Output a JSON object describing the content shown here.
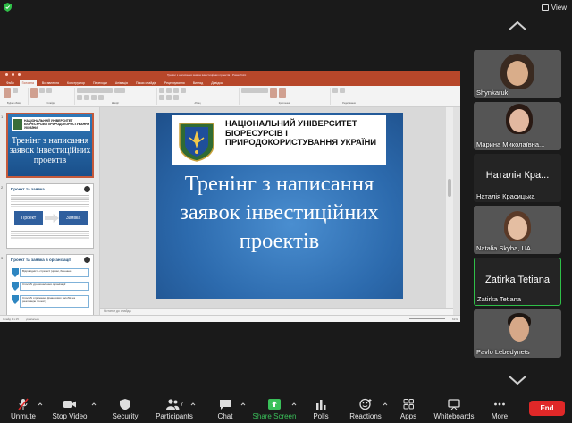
{
  "app": {
    "view_label": "View",
    "colors": {
      "share_green": "#3ac05a",
      "end_red": "#e02828",
      "ppt_accent": "#b7472a"
    }
  },
  "presentation": {
    "window_title": "Тренінг з написання заявок інвестиційних проектів - PowerPoint",
    "tabs": [
      "Файл",
      "Головна",
      "Вставлення",
      "Конструктор",
      "Переходи",
      "Анімація",
      "Показ слайдів",
      "Рецензування",
      "Вигляд",
      "Довідка"
    ],
    "active_tab": "Головна",
    "ribbon_groups": [
      "Буфер обміну",
      "Слайди",
      "Шрифт",
      "Абзац",
      "Креслення",
      "Редагування"
    ],
    "notes_placeholder": "Нотатки до слайда",
    "status": {
      "slide": "Слайд 1 з 15",
      "language": "українська",
      "zoom": "61%"
    },
    "thumbnails": [
      {
        "num": "1",
        "title_box": "НАЦІОНАЛЬНИЙ УНІВЕРСИТЕТ БІОРЕСУРСІВ І ПРИРОДОКОРИСТУВАННЯ УКРАЇНИ",
        "big": "Тренінг з написання заявок інвестиційних проектів"
      },
      {
        "num": "2",
        "header": "Проект та заявка",
        "shape_left": "Проект",
        "shape_right": "Заявка"
      },
      {
        "num": "3",
        "header": "Проект та заявка в організації",
        "rows": [
          "Відповідність стратегії (цілям, баченню)",
          "Способі удосконалення організації",
          "Способі отримання фінансових засобів на реалізацію проекту"
        ]
      }
    ],
    "slide": {
      "university": "НАЦІОНАЛЬНИЙ УНІВЕРСИТЕТ БІОРЕСУРСІВ І ПРИРОДОКОРИСТУВАННЯ УКРАЇНИ",
      "title": "Тренінг з написання заявок інвестиційних проектів"
    }
  },
  "participants": [
    {
      "name": "Shynkaruk",
      "has_video": true
    },
    {
      "name": "Марина Миколаївна...",
      "has_video": true
    },
    {
      "name": "Наталія Красицька",
      "display": "Наталія Кра...",
      "has_video": false
    },
    {
      "name": "Natalia Skyba, UA",
      "has_video": true
    },
    {
      "name": "Zatirka Tetiana",
      "display": "Zatirka Tetiana",
      "has_video": false,
      "active_speaker": true
    },
    {
      "name": "Pavlo Lebedynets",
      "has_video": true
    }
  ],
  "toolbar": {
    "unmute": "Unmute",
    "stop_video": "Stop Video",
    "security": "Security",
    "participants": "Participants",
    "participants_count": "7",
    "chat": "Chat",
    "share_screen": "Share Screen",
    "polls": "Polls",
    "reactions": "Reactions",
    "apps": "Apps",
    "whiteboards": "Whiteboards",
    "more": "More",
    "end": "End"
  }
}
